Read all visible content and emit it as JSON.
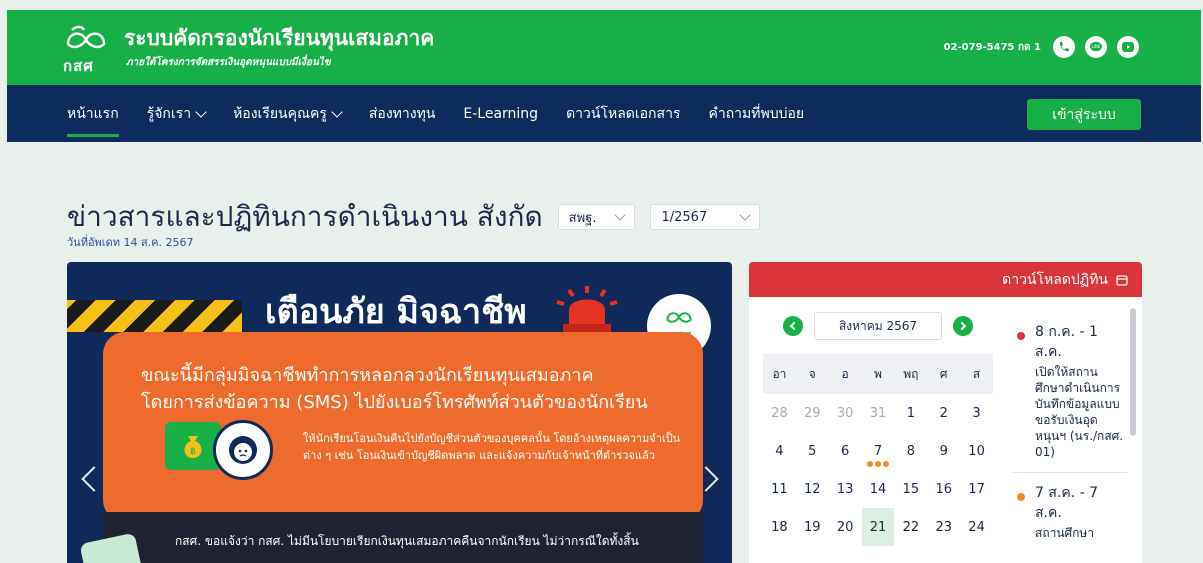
{
  "header": {
    "logo_text": "กสศ",
    "title": "ระบบคัดกรองนักเรียนทุนเสมอภาค",
    "subtitle": "ภายใต้โครงการจัดสรรเงินอุดหนุนแบบมีเงื่อนไข",
    "phone": "02-079-5475 กด 1",
    "icons": [
      "phone-icon",
      "line-icon",
      "youtube-icon"
    ]
  },
  "nav": {
    "items": [
      {
        "label": "หน้าแรก",
        "active": true
      },
      {
        "label": "รู้จักเรา",
        "dropdown": true
      },
      {
        "label": "ห้องเรียนคุณครู",
        "dropdown": true
      },
      {
        "label": "ส่องทางทุน"
      },
      {
        "label": "E-Learning"
      },
      {
        "label": "ดาวน์โหลดเอกสาร"
      },
      {
        "label": "คำถามที่พบบ่อย"
      }
    ],
    "login_label": "เข้าสู่ระบบ"
  },
  "page": {
    "title": "ข่าวสารและปฏิทินการดำเนินงาน  สังกัด",
    "affiliation_select": "สพฐ.",
    "term_select": "1/2567",
    "updated": "วันที่อัพเดท 14 ส.ค. 2567"
  },
  "banner": {
    "title": "เตือนภัย มิจฉาชีพ",
    "badge": "กสศ",
    "line1": "ขณะนี้มีกลุ่มมิจฉาชีพทำการหลอกลวงนักเรียนทุนเสมอภาค",
    "line2": "โดยการส่งข้อความ (SMS) ไปยังเบอร์โทรศัพท์ส่วนตัวของนักเรียน",
    "detail": "ให้นักเรียนโอนเงินคืนไปยังบัญชีส่วนตัวของบุคคลนั้น โดยอ้างเหตุผลความจำเป็นต่าง ๆ เช่น โอนเงินเข้าบัญชีผิดพลาด และแจ้งความกับเจ้าหน้าที่ตำรวจแล้ว",
    "bottom": "กสศ. ขอแจ้งว่า กสศ. ไม่มีนโยบายเรียกเงินทุนเสมอภาคคืนจากนักเรียน ไม่ว่ากรณีใดทั้งสิ้น"
  },
  "calendar": {
    "panel_title": "ดาวน์โหลดปฏิทิน",
    "month": "สิงหาคม 2567",
    "weekdays": [
      "อา",
      "จ",
      "อ",
      "พ",
      "พฤ",
      "ศ",
      "ส"
    ],
    "weeks": [
      [
        "28",
        "29",
        "30",
        "31",
        "1",
        "2",
        "3"
      ],
      [
        "4",
        "5",
        "6",
        "7",
        "8",
        "9",
        "10"
      ],
      [
        "11",
        "12",
        "13",
        "14",
        "15",
        "16",
        "17"
      ],
      [
        "18",
        "19",
        "20",
        "21",
        "22",
        "23",
        "24"
      ]
    ],
    "events": [
      {
        "date": "8 ก.ค. - 1 ส.ค.",
        "desc": "เปิดให้สถานศึกษาดำเนินการบันทึกข้อมูลแบบขอรับเงินอุดหนุนฯ (นร./กสศ. 01)",
        "color": "#d9353b"
      },
      {
        "date": "7 ส.ค. - 7 ส.ค.",
        "desc": "สถานศึกษา",
        "color": "#f08a2a"
      }
    ]
  },
  "colors": {
    "green": "#17b047",
    "navy": "#0d2b5c",
    "red": "#d9353b",
    "orange": "#ee6a2d"
  }
}
